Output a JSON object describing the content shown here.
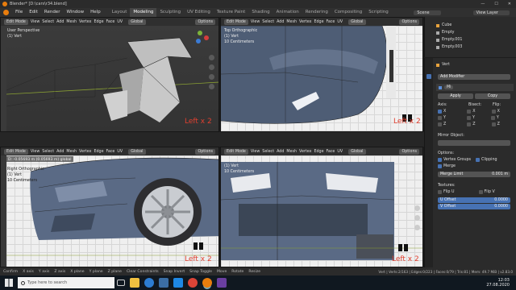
{
  "titlebar": {
    "title": "Blender* [D:\\cars\\r34.blend]",
    "minimize": "—",
    "maximize": "☐",
    "close": "✕"
  },
  "menu": {
    "items": [
      "File",
      "Edit",
      "Render",
      "Window",
      "Help"
    ]
  },
  "workspaces": {
    "tabs": [
      "Layout",
      "Modeling",
      "Sculpting",
      "UV Editing",
      "Texture Paint",
      "Shading",
      "Animation",
      "Rendering",
      "Compositing",
      "Scripting"
    ],
    "active": "Modeling"
  },
  "scene": {
    "scene_label": "Scene",
    "view_layer_label": "View Layer"
  },
  "viewports": {
    "top_left": {
      "mode": "Edit Mode",
      "menus": [
        "View",
        "Select",
        "Add",
        "Mesh",
        "Vertex",
        "Edge",
        "Face",
        "UV"
      ],
      "transform": "Global",
      "options": "Options",
      "info_line1": "User Perspective",
      "info_line2": "(1) Vert",
      "label": "Left x 2"
    },
    "top_right": {
      "mode": "Edit Mode",
      "menus": [
        "View",
        "Select",
        "Add",
        "Mesh",
        "Vertex",
        "Edge",
        "Face",
        "UV"
      ],
      "transform": "Global",
      "options": "Options",
      "info_line1": "Top Orthographic",
      "info_line2": "(1) Vert",
      "info_line3": "10 Centimeters",
      "label": "Left x 2"
    },
    "bottom_left": {
      "mode": "Edit Mode",
      "menus": [
        "View",
        "Select",
        "Add",
        "Mesh",
        "Vertex",
        "Edge",
        "Face",
        "UV"
      ],
      "transform": "Global",
      "options": "Options",
      "info_line0": "D: -0.05693 m (0.05693 m) global",
      "info_line1": "Right Orthographic",
      "info_line2": "(1) Vert",
      "info_line3": "10 Centimeters",
      "label": "Left x 2"
    },
    "bottom_right": {
      "mode": "Edit Mode",
      "menus": [
        "View",
        "Select",
        "Add",
        "Mesh",
        "Vertex",
        "Edge",
        "Face",
        "UV"
      ],
      "transform": "Global",
      "options": "Options",
      "info_line1": "Front Orthographic",
      "info_line2": "(1) Vert",
      "info_line3": "10 Centimeters",
      "label": "Left x 2"
    }
  },
  "outliner": {
    "items": [
      "Cube",
      "Empty",
      "Empty.001",
      "Empty.003"
    ]
  },
  "properties": {
    "object_name": "Vert",
    "add_modifier": "Add Modifier",
    "modifier_name": "Mi",
    "apply": "Apply",
    "copy": "Copy",
    "axis_label": "Axis:",
    "bisect_label": "Bisect:",
    "flip_label": "Flip:",
    "axes": [
      "X",
      "Y",
      "Z"
    ],
    "mirror_object": "Mirror Object:",
    "options_label": "Options:",
    "vertex_groups": "Vertex Groups",
    "clipping": "Clipping",
    "merge": "Merge",
    "merge_limit_label": "Merge Limit",
    "merge_limit_value": "0.001 m",
    "textures_label": "Textures:",
    "flip_u": "Flip U",
    "flip_v": "Flip V",
    "u_offset_label": "U Offset",
    "u_offset_value": "0.0000",
    "v_offset_label": "V Offset",
    "v_offset_value": "0.0000"
  },
  "statusbar": {
    "items": [
      "Confirm",
      "X axis",
      "Y axis",
      "Z axis",
      "X plane",
      "Y plane",
      "Z plane",
      "Clear Constraints",
      "Snap Invert",
      "Snap Toggle",
      "Move",
      "Rotate",
      "Resize"
    ],
    "stats": "Vert | Verts:2/163 | Edges:0/223 | Faces:0/79 | Tris:81 | Mem: 49.7 MiB | v2.83.0"
  },
  "taskbar": {
    "search": "Type here to search",
    "time": "12:03",
    "date": "27.08.2020"
  }
}
